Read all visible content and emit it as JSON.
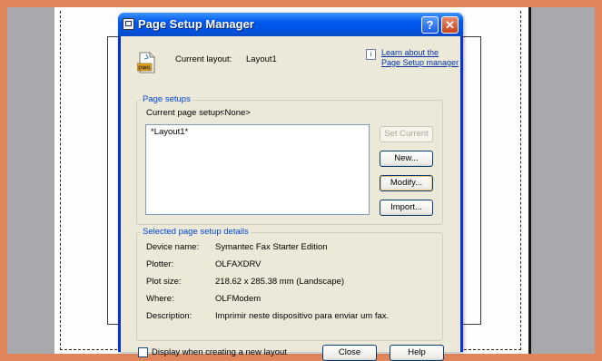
{
  "dialog": {
    "title": "Page Setup Manager",
    "titlebar_help": "?",
    "titlebar_close": "✕"
  },
  "header": {
    "current_layout_label": "Current layout:",
    "current_layout_value": "Layout1",
    "info_icon": "i",
    "learn_link_line1": "Learn about the",
    "learn_link_line2": "Page Setup manager",
    "file_icon": "DWG"
  },
  "page_setups": {
    "legend": "Page setups",
    "current_label": "Current page setup:",
    "current_value": "<None>",
    "list_items": [
      "*Layout1*"
    ],
    "buttons": {
      "set_current": "Set Current",
      "new": "New...",
      "modify": "Modify...",
      "import": "Import..."
    }
  },
  "details": {
    "legend": "Selected page setup details",
    "rows": [
      {
        "label": "Device name:",
        "value": "Symantec Fax Starter Edition"
      },
      {
        "label": "Plotter:",
        "value": "OLFAXDRV"
      },
      {
        "label": "Plot size:",
        "value": "218.62 x 285.38 mm (Landscape)"
      },
      {
        "label": "Where:",
        "value": "OLFModem"
      },
      {
        "label": "Description:",
        "value": "Imprimir neste dispositivo para enviar um fax."
      }
    ]
  },
  "footer": {
    "checkbox_label": "Display when creating a new layout",
    "checkbox_checked": false,
    "close": "Close",
    "help": "Help"
  }
}
